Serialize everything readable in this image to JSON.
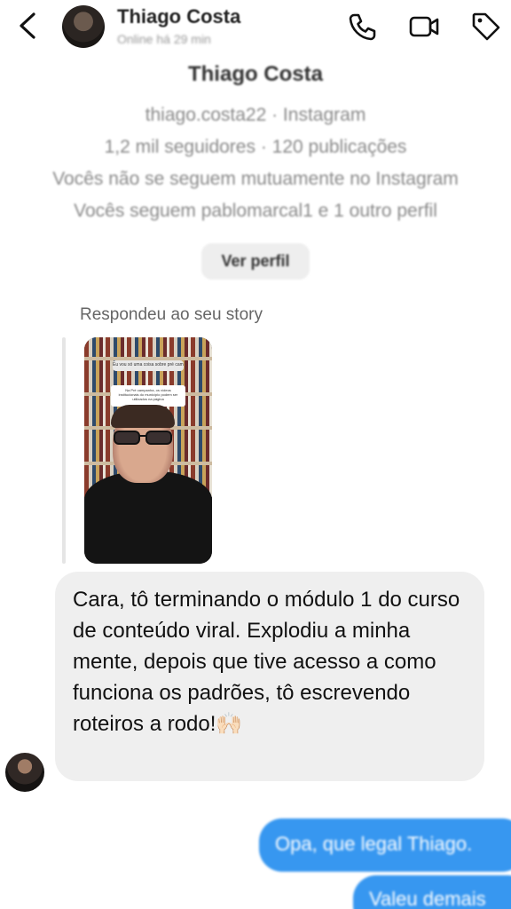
{
  "header": {
    "contact_name": "Thiago Costa",
    "status": "Online há 29 min",
    "icons": [
      "back-arrow-icon",
      "phone-icon",
      "video-camera-icon",
      "tag-icon"
    ]
  },
  "profile": {
    "name": "Thiago Costa",
    "username_line": "thiago.costa22 · Instagram",
    "stats_line": "1,2 mil seguidores · 120 publicações",
    "mutual_line": "Vocês não se seguem mutuamente no Instagram",
    "following_line": "Vocês seguem pablomarcal1 e 1 outro perfil",
    "view_profile_label": "Ver perfil"
  },
  "story_reply": {
    "label": "Respondeu ao seu story",
    "story_question": "Eu vou só uma coisa sobre pré campanha",
    "story_card_text": "Na Pré campanha, os vídeos institucionais do município podem ser utilizados na página"
  },
  "messages": {
    "incoming": "Cara, tô terminando o módulo 1 do curso de conteúdo viral. Explodiu a minha mente, depois que tive acesso a como funciona os padrões, tô escrevendo roteiros a rodo!🙌🏻",
    "outgoing": [
      "Opa, que legal Thiago.",
      "Valeu demais"
    ]
  },
  "colors": {
    "outgoing_bubble": "#3797f0",
    "incoming_bubble": "#efefef"
  }
}
